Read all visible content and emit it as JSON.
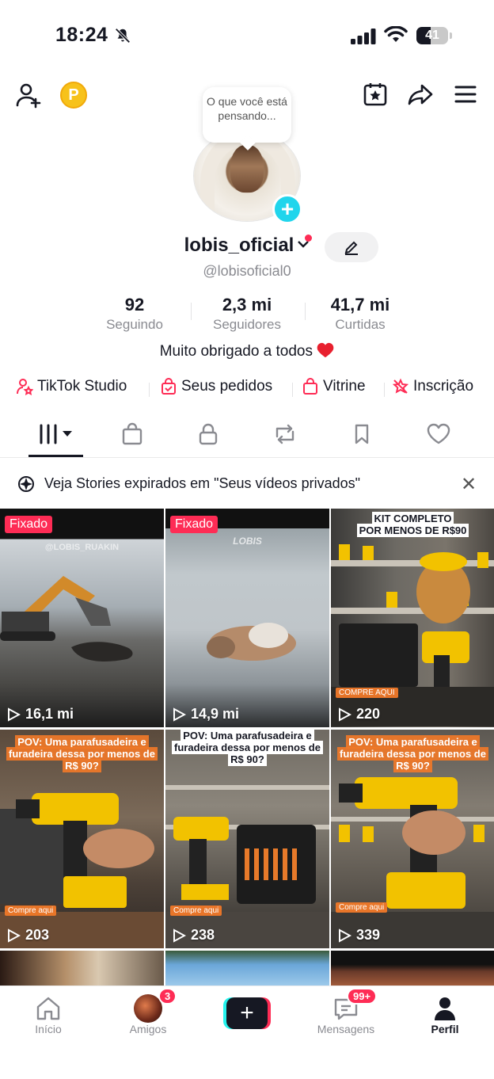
{
  "status": {
    "time": "18:24",
    "battery": "41"
  },
  "profile": {
    "bubble": "O que você está pensando...",
    "username": "lobis_oficial",
    "handle": "@lobisoficial0",
    "bio": "Muito obrigado a todos"
  },
  "stats": [
    {
      "num": "92",
      "label": "Seguindo"
    },
    {
      "num": "2,3 mi",
      "label": "Seguidores"
    },
    {
      "num": "41,7 mi",
      "label": "Curtidas"
    }
  ],
  "links": [
    {
      "label": "TikTok Studio",
      "icon": "person-star-icon"
    },
    {
      "label": "Seus pedidos",
      "icon": "bag-check-icon"
    },
    {
      "label": "Vitrine",
      "icon": "shopping-bag-icon"
    },
    {
      "label": "Inscrição",
      "icon": "subscription-icon"
    }
  ],
  "banner": {
    "text": "Veja Stories expirados em \"Seus vídeos privados\""
  },
  "videos": [
    {
      "pinned": "Fixado",
      "views": "16,1 mi",
      "watermark": "@LOBIS_RUAKIN"
    },
    {
      "pinned": "Fixado",
      "views": "14,9 mi",
      "watermark": "LOBIS"
    },
    {
      "views": "220",
      "caption1": "KIT COMPLETO",
      "caption2": "POR MENOS DE R$90",
      "tag": "COMPRE AQUI"
    },
    {
      "views": "203",
      "caption1": "POV: Uma parafusadeira e",
      "caption2": "furadeira dessa por menos de",
      "caption3": "R$ 90?",
      "tag": "Compre aqui"
    },
    {
      "views": "238",
      "caption1": "POV: Uma parafusadeira e",
      "caption2": "furadeira dessa por menos de",
      "caption3": "R$ 90?",
      "tag": "Compre aqui"
    },
    {
      "views": "339",
      "caption1": "POV: Uma parafusadeira e",
      "caption2": "furadeira dessa por menos de",
      "caption3": "R$ 90?",
      "tag": "Compre aqui"
    }
  ],
  "nav": {
    "home": "Início",
    "friends": "Amigos",
    "friends_badge": "3",
    "inbox": "Mensagens",
    "inbox_badge": "99+",
    "profile": "Perfil"
  },
  "colors": {
    "accent": "#fe2c55",
    "cyan": "#20d5ec"
  }
}
